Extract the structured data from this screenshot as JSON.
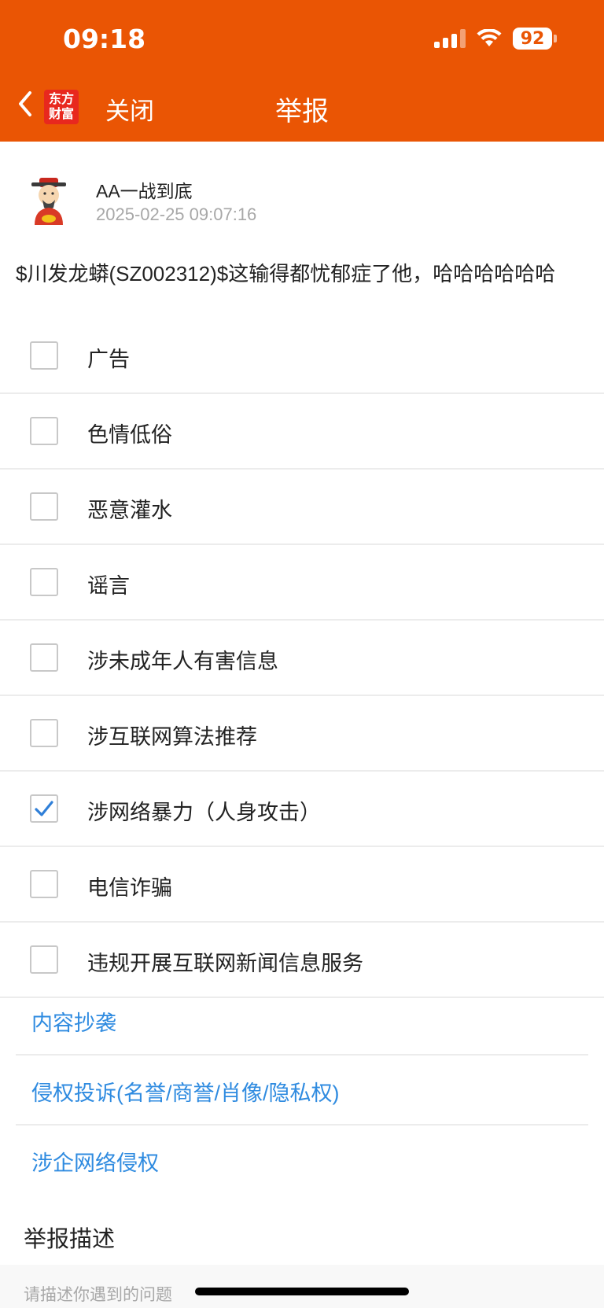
{
  "status_bar": {
    "time": "09:18",
    "battery": "92"
  },
  "nav": {
    "logo_line1": "东方",
    "logo_line2": "财富",
    "close_label": "关闭",
    "title": "举报"
  },
  "post": {
    "username": "AA一战到底",
    "timestamp": "2025-02-25 09:07:16",
    "content": "$川发龙蟒(SZ002312)$这输得都忧郁症了他，哈哈哈哈哈哈"
  },
  "options": [
    {
      "label": "广告",
      "checked": false
    },
    {
      "label": "色情低俗",
      "checked": false
    },
    {
      "label": "恶意灌水",
      "checked": false
    },
    {
      "label": "谣言",
      "checked": false
    },
    {
      "label": "涉未成年人有害信息",
      "checked": false
    },
    {
      "label": "涉互联网算法推荐",
      "checked": false
    },
    {
      "label": "涉网络暴力（人身攻击）",
      "checked": true
    },
    {
      "label": "电信诈骗",
      "checked": false
    },
    {
      "label": "违规开展互联网新闻信息服务",
      "checked": false
    }
  ],
  "links": [
    {
      "label": "内容抄袭"
    },
    {
      "label": "侵权投诉(名誉/商誉/肖像/隐私权)"
    },
    {
      "label": "涉企网络侵权"
    }
  ],
  "description": {
    "title": "举报描述",
    "placeholder": "请描述你遇到的问题"
  },
  "colors": {
    "brand": "#ea5504",
    "link": "#2f8be0",
    "check": "#2f7fd8"
  }
}
